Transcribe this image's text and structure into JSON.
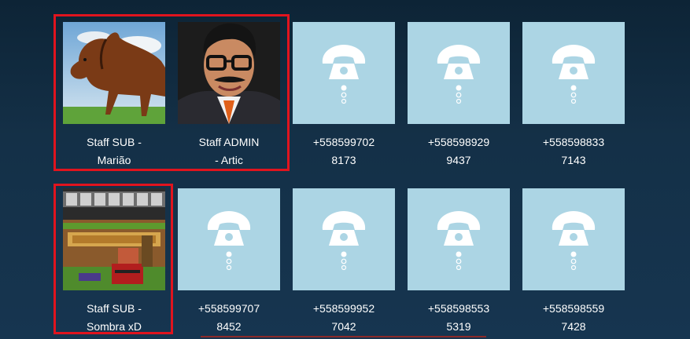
{
  "contacts_row1": [
    {
      "name_line1": "Staff SUB -",
      "name_line2": "Marião",
      "avatar": "horse-photo"
    },
    {
      "name_line1": "Staff ADMIN",
      "name_line2": "- Artic",
      "avatar": "man-with-glasses-photo"
    },
    {
      "name_line1": "+558599702",
      "name_line2": "8173",
      "avatar": "phone-icon"
    },
    {
      "name_line1": "+558598929",
      "name_line2": "9437",
      "avatar": "phone-icon"
    },
    {
      "name_line1": "+558598833",
      "name_line2": "7143",
      "avatar": "phone-icon"
    }
  ],
  "contacts_row2": [
    {
      "name_line1": "Staff SUB -",
      "name_line2": "Sombra xD",
      "avatar": "minecraft-sombra-image"
    },
    {
      "name_line1": "+558599707",
      "name_line2": "8452",
      "avatar": "phone-icon"
    },
    {
      "name_line1": "+558599952",
      "name_line2": "7042",
      "avatar": "phone-icon"
    },
    {
      "name_line1": "+558598553",
      "name_line2": "5319",
      "avatar": "phone-icon"
    },
    {
      "name_line1": "+558598559",
      "name_line2": "7428",
      "avatar": "phone-icon"
    }
  ],
  "colors": {
    "background": "#143047",
    "placeholder": "#acd5e4",
    "highlight": "#e0141e",
    "text": "#ffffff"
  }
}
